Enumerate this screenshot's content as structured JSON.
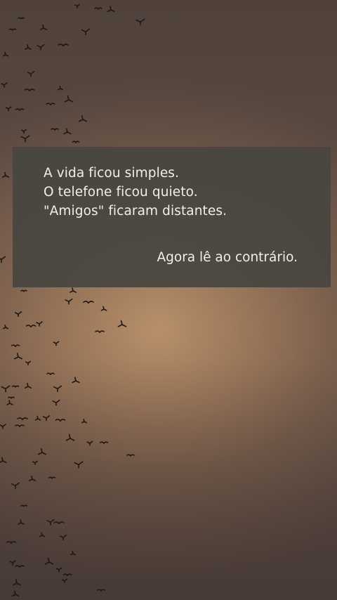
{
  "quote": {
    "lines": [
      "A vida ficou simples.",
      "O telefone ficou quieto.",
      "\"Amigos\" ficaram distantes."
    ],
    "punchline": "Agora lê ao contrário."
  },
  "colors": {
    "sky_glow": "#b8906a",
    "sky_edge": "#5b4a43",
    "box_bg": "#48463f",
    "text": "#f2efe9",
    "birds": "#1e1814"
  },
  "background": {
    "subject": "flock-of-birds-icon"
  }
}
